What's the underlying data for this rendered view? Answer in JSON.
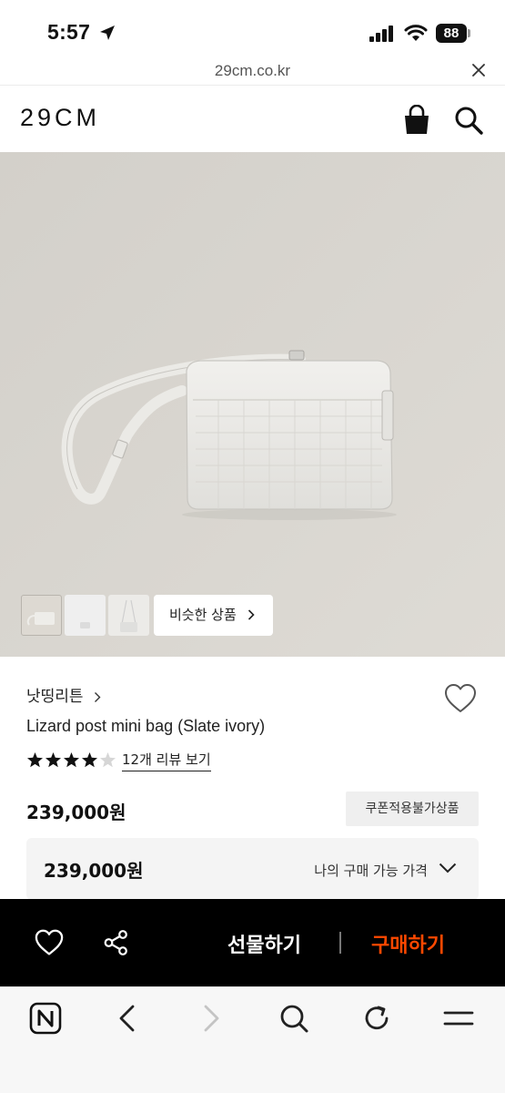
{
  "status_bar": {
    "time": "5:57",
    "battery": "88"
  },
  "url_bar": {
    "url": "29cm.co.kr"
  },
  "header": {
    "logo": "29CM"
  },
  "gallery": {
    "similar_label": "비슷한 상품"
  },
  "product": {
    "brand": "낫띵리튼",
    "name": "Lizard post mini bag (Slate ivory)",
    "rating": 4.5,
    "review_link": "12개 리뷰 보기",
    "price": "239,000원",
    "coupon_badge": "쿠폰적용불가상품",
    "my_price": "239,000원",
    "my_price_label": "나의 구매 가능 가격"
  },
  "buy_bar": {
    "gift_label": "선물하기",
    "purchase_label": "구매하기"
  },
  "colors": {
    "accent": "#ff4800",
    "bar_bg": "#000000",
    "hero_bg": "#d9d6d0"
  }
}
